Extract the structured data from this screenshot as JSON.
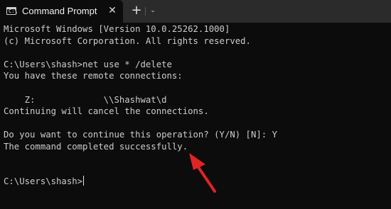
{
  "tab": {
    "title": "Command Prompt",
    "icon": "terminal-icon",
    "close_icon": "close-icon",
    "prompt_glyph": "C:\\"
  },
  "titlebar": {
    "new_tab_glyph": "+",
    "dropdown_glyph": "⌄"
  },
  "terminal": {
    "lines": [
      "Microsoft Windows [Version 10.0.25262.1000]",
      "(c) Microsoft Corporation. All rights reserved.",
      "",
      "C:\\Users\\shash>net use * /delete",
      "You have these remote connections:",
      "",
      "    Z:             \\\\Shashwat\\d",
      "Continuing will cancel the connections.",
      "",
      "Do you want to continue this operation? (Y/N) [N]: Y",
      "The command completed successfully.",
      "",
      "",
      "C:\\Users\\shash>"
    ]
  },
  "annotation": {
    "arrow_color": "#e02424"
  }
}
